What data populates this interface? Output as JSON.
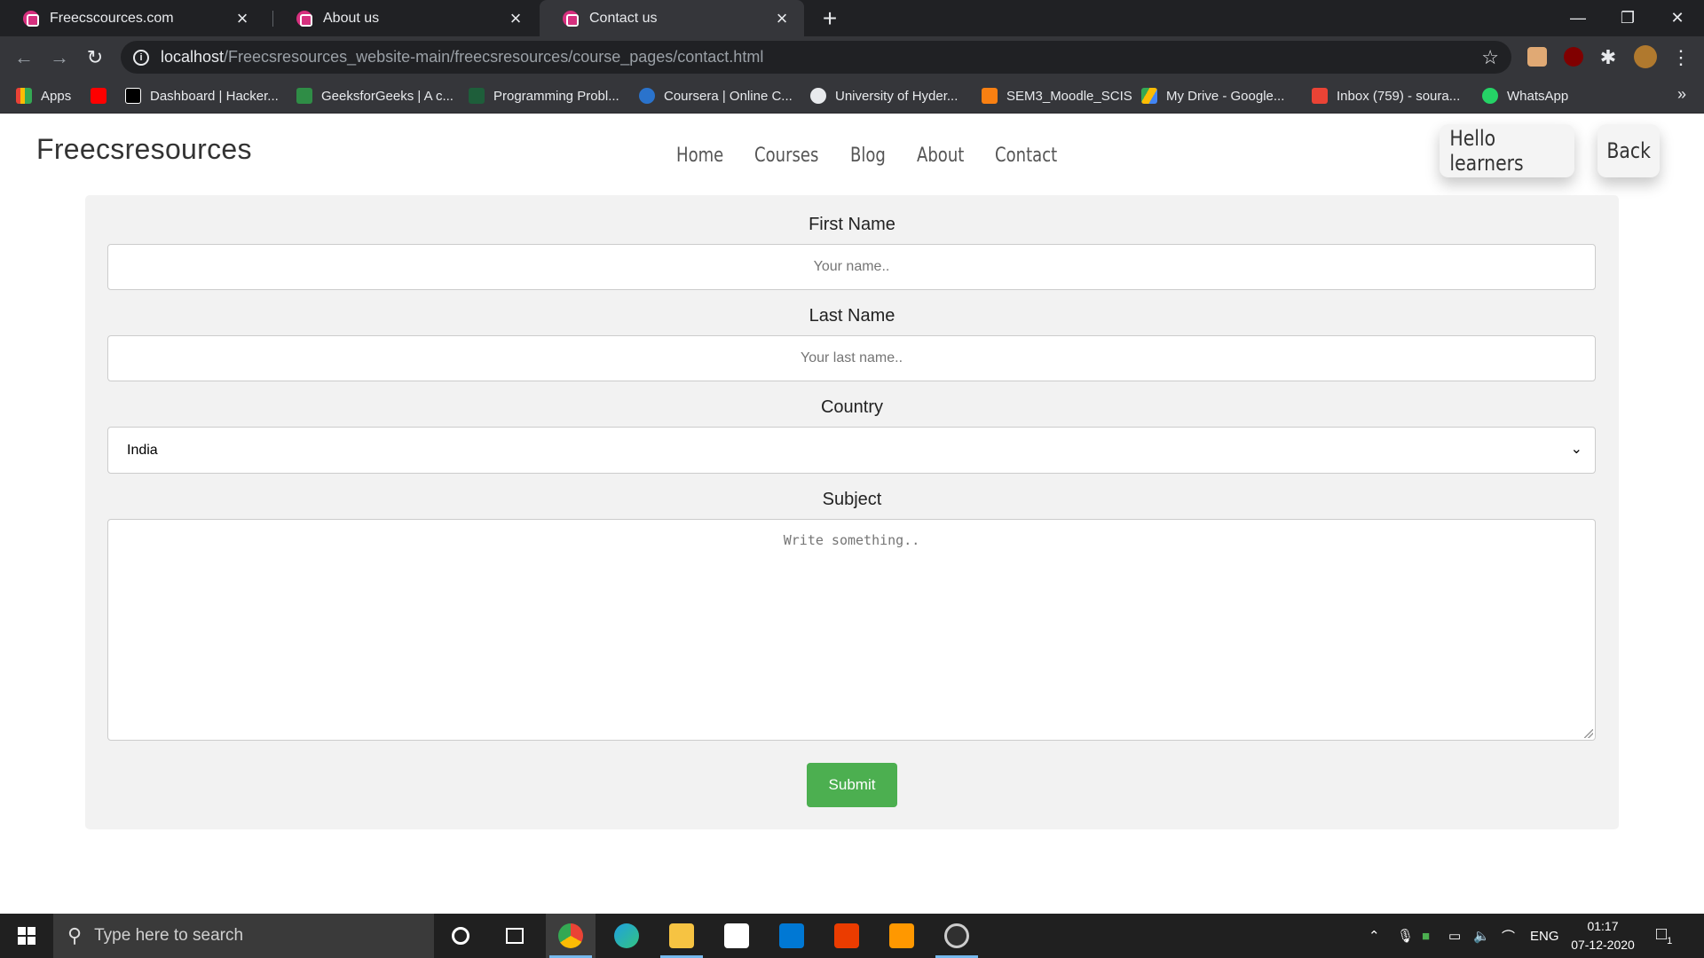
{
  "browser": {
    "tabs": [
      {
        "title": "Freecscources.com",
        "active": false
      },
      {
        "title": "About us",
        "active": false
      },
      {
        "title": "Contact us",
        "active": true
      }
    ],
    "new_tab_icon": "plus-icon",
    "window_controls": {
      "minimize": "—",
      "restore": "❐",
      "close": "✕"
    },
    "url_host": "localhost",
    "url_path": "/Freecsresources_website-main/freecsresources/course_pages/contact.html",
    "bookmarks": [
      {
        "label": "Apps",
        "color": "#4285f4"
      },
      {
        "label": "",
        "color": "#ff0000"
      },
      {
        "label": "Dashboard | Hacker...",
        "color": "#000000"
      },
      {
        "label": "GeeksforGeeks | A c...",
        "color": "#2f8d46"
      },
      {
        "label": "Programming Probl...",
        "color": "#1e5e3a"
      },
      {
        "label": "Coursera | Online C...",
        "color": "#2a73cc"
      },
      {
        "label": "University of Hyder...",
        "color": "#e8eaed"
      },
      {
        "label": "SEM3_Moodle_SCIS",
        "color": "#f98012"
      },
      {
        "label": "My Drive - Google...",
        "color": "#fbbc04"
      },
      {
        "label": "Inbox (759) - soura...",
        "color": "#ea4335"
      },
      {
        "label": "WhatsApp",
        "color": "#25d366"
      }
    ],
    "bookmarks_overflow": "»"
  },
  "site": {
    "brand": "Freecsresources",
    "nav": [
      "Home",
      "Courses",
      "Blog",
      "About",
      "Contact"
    ],
    "greeting_button": "Hello learners",
    "back_button": "Back"
  },
  "form": {
    "first_name_label": "First Name",
    "first_name_placeholder": "Your name..",
    "last_name_label": "Last Name",
    "last_name_placeholder": "Your last name..",
    "country_label": "Country",
    "country_value": "India",
    "subject_label": "Subject",
    "subject_placeholder": "Write something..",
    "submit_label": "Submit"
  },
  "taskbar": {
    "search_placeholder": "Type here to search",
    "apps": [
      {
        "name": "cortana",
        "color": "#ffffff"
      },
      {
        "name": "task-view",
        "color": "#ffffff"
      },
      {
        "name": "chrome",
        "color": "#fbbc04",
        "active": true
      },
      {
        "name": "edge",
        "color": "#1fa0e0"
      },
      {
        "name": "file-explorer",
        "color": "#f6c342"
      },
      {
        "name": "store",
        "color": "#ffffff"
      },
      {
        "name": "mail",
        "color": "#0078d4"
      },
      {
        "name": "office",
        "color": "#eb3c00"
      },
      {
        "name": "sublime-text",
        "color": "#ff9800"
      },
      {
        "name": "obs",
        "color": "#cccccc"
      }
    ],
    "language": "ENG",
    "time": "01:17",
    "date": "07-12-2020",
    "notification_count": "1"
  }
}
